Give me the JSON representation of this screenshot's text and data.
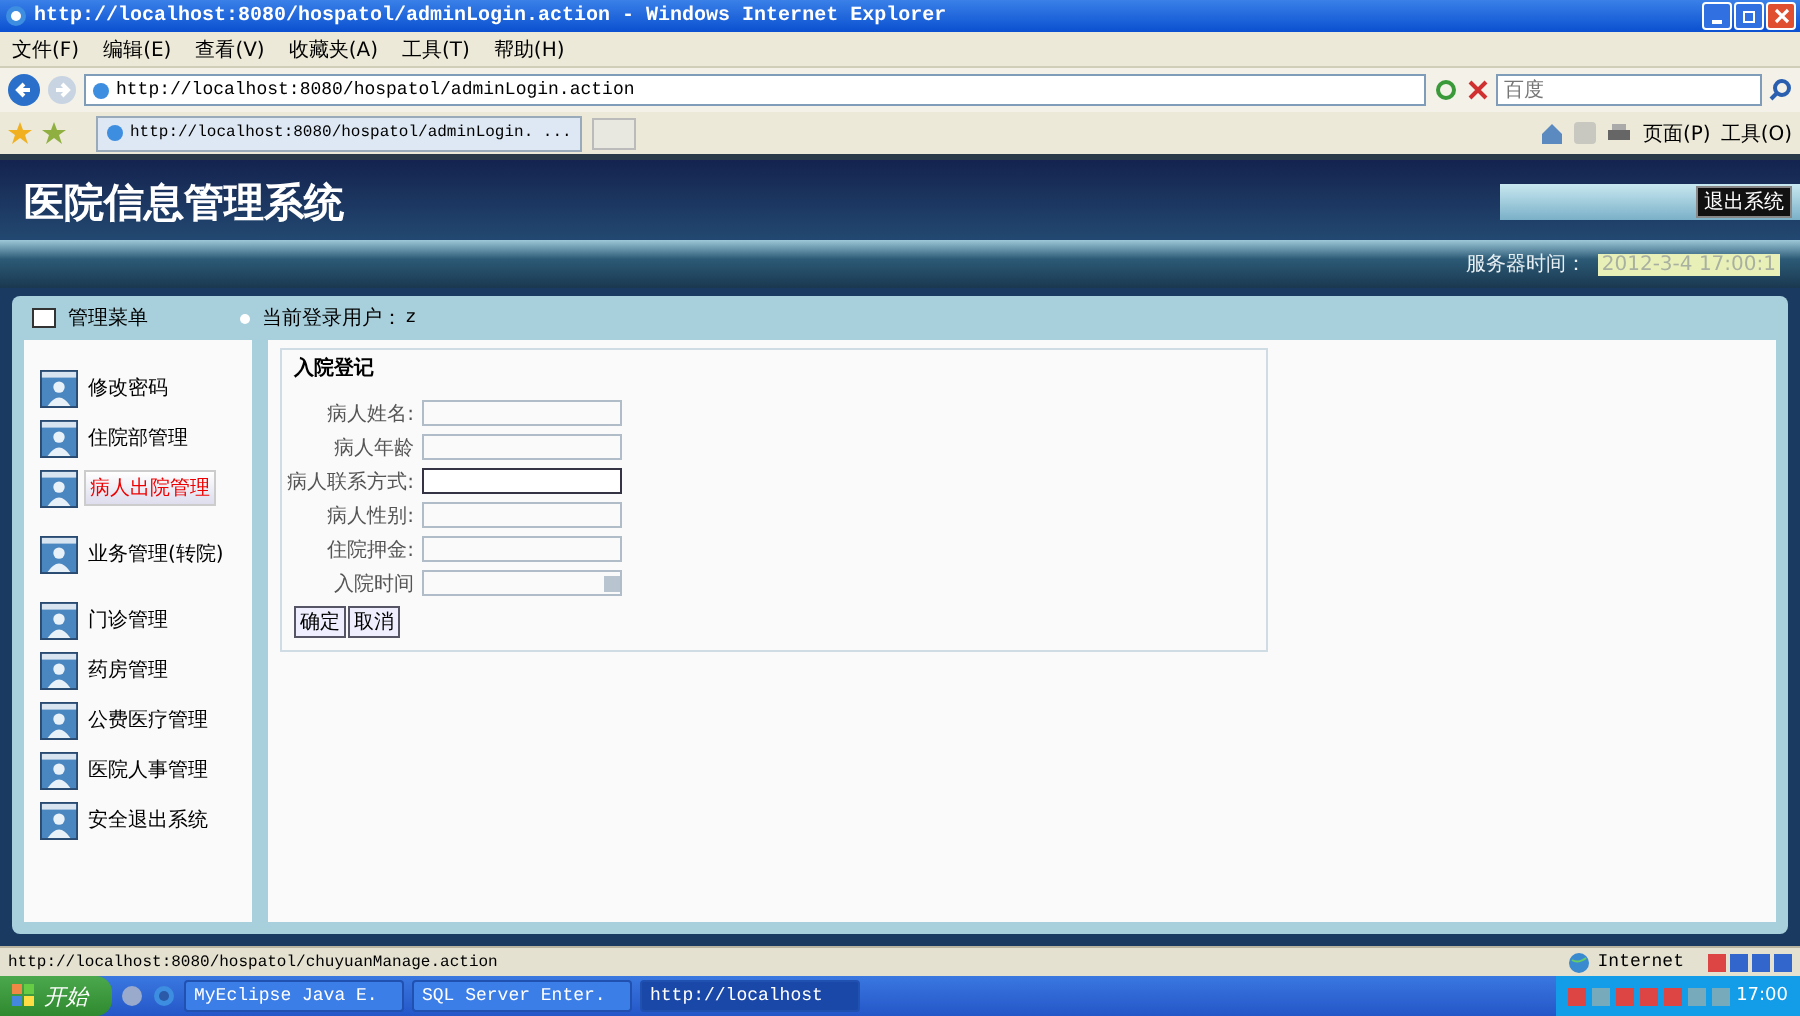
{
  "window": {
    "title": "http://localhost:8080/hospatol/adminLogin.action - Windows Internet Explorer"
  },
  "menu": [
    "文件(F)",
    "编辑(E)",
    "查看(V)",
    "收藏夹(A)",
    "工具(T)",
    "帮助(H)"
  ],
  "address": {
    "url": "http://localhost:8080/hospatol/adminLogin.action"
  },
  "search": {
    "placeholder": "百度"
  },
  "tab": {
    "title": "http://localhost:8080/hospatol/adminLogin. ..."
  },
  "toolbar": [
    "页面(P)",
    "工具(O)"
  ],
  "header": {
    "title": "医院信息管理系统",
    "logout": "退出系统",
    "time_label": "服务器时间：",
    "time": "2012-3-4 17:00:1"
  },
  "panel": {
    "menu_title": "管理菜单",
    "user_label": "当前登录用户：",
    "user": "z"
  },
  "sidebar": {
    "items": [
      {
        "label": "修改密码",
        "selected": false
      },
      {
        "label": "住院部管理",
        "selected": false
      },
      {
        "label": "病人出院管理",
        "selected": true
      },
      {
        "label": "业务管理(转院)",
        "selected": false
      },
      {
        "label": "门诊管理",
        "selected": false
      },
      {
        "label": "药房管理",
        "selected": false
      },
      {
        "label": "公费医疗管理",
        "selected": false
      },
      {
        "label": "医院人事管理",
        "selected": false
      },
      {
        "label": "安全退出系统",
        "selected": false
      }
    ]
  },
  "form": {
    "legend": "入院登记",
    "fields": [
      {
        "label": "病人姓名:",
        "kind": "text",
        "focused": false
      },
      {
        "label": "病人年龄",
        "kind": "text",
        "focused": false
      },
      {
        "label": "病人联系方式:",
        "kind": "text",
        "focused": true
      },
      {
        "label": "病人性别:",
        "kind": "text",
        "focused": false
      },
      {
        "label": "住院押金:",
        "kind": "text",
        "focused": false
      },
      {
        "label": "入院时间",
        "kind": "date",
        "focused": false
      }
    ],
    "buttons": [
      "确定",
      "取消"
    ]
  },
  "status_bar": {
    "url": "http://localhost:8080/hospatol/chuyuanManage.action",
    "zone": "Internet"
  },
  "taskbar": {
    "start": "开始",
    "tasks": [
      {
        "label": "MyEclipse Java E.",
        "selected": false
      },
      {
        "label": "SQL Server Enter.",
        "selected": false
      },
      {
        "label": "http://localhost",
        "selected": true
      }
    ],
    "clock": "17:00"
  }
}
